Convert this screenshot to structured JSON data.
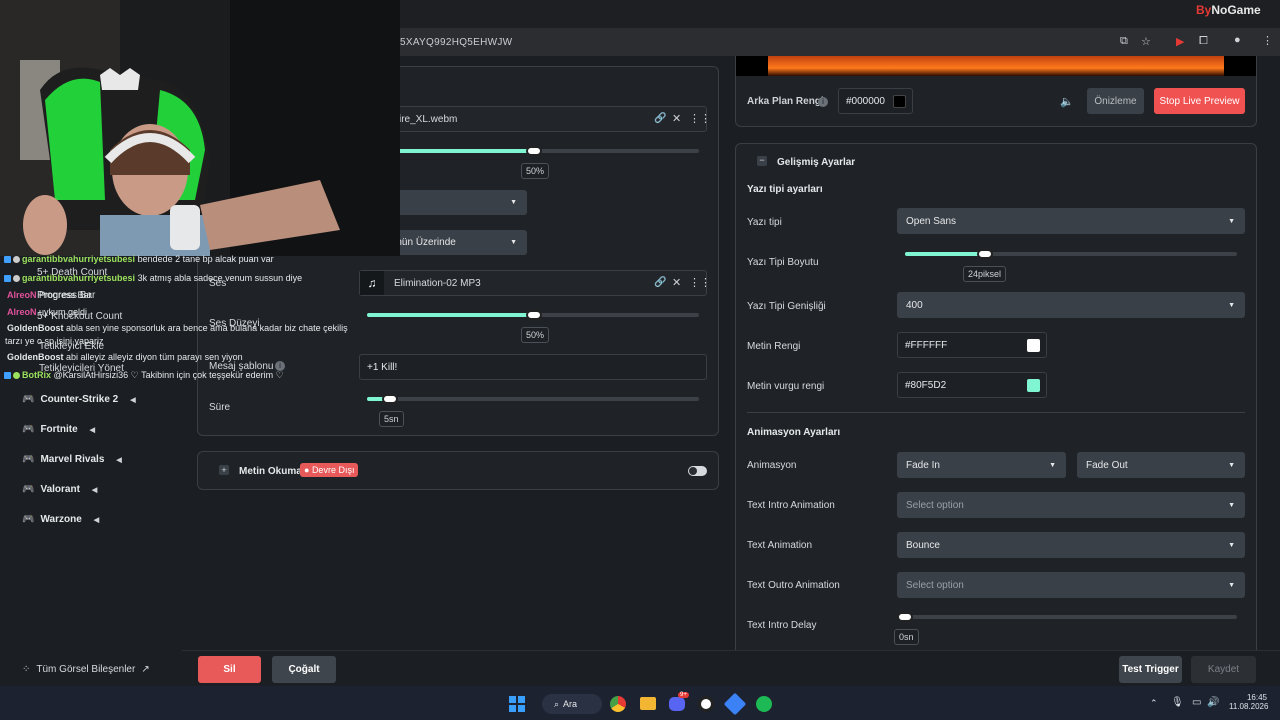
{
  "brand": {
    "logo_a": "By",
    "logo_b": "NoGame"
  },
  "browser": {
    "url": "5XAYQ992HQ5EHWJW"
  },
  "left_panel": {
    "file1": "ire_XL.webm",
    "volume1": "50%",
    "select1_value": "",
    "select2_value": "örüntünün Üzerinde",
    "sound_label": "Ses",
    "file2": "Elimination-02 MP3",
    "volume_label": "Ses Düzeyi",
    "volume2": "50%",
    "template_label": "Mesaj şablonu",
    "template_value": "+1 Kill!",
    "duration_label": "Süre",
    "duration_value": "5sn",
    "tts_label": "Metin Okuma",
    "tts_status": "Devre Dışı"
  },
  "sidebar": {
    "ghost_items": [
      "5+ Death Count",
      "Progress Bar",
      "5+ Knockout Count",
      "Tetikleyici Ekle",
      "Tetikleyicileri Yönet"
    ],
    "games": [
      "Counter-Strike 2",
      "Fortnite",
      "Marvel Rivals",
      "Valorant",
      "Warzone"
    ],
    "footer_link": "Tüm Görsel Bileşenler"
  },
  "chat": [
    {
      "name": "garantibbvahurriyetsubesi",
      "text": "bendede 2 tane bp alcak puan var",
      "color": "#9be15d"
    },
    {
      "name": "garantibbvahurriyetsubesi",
      "text": "3k atmış abla sadece venum sussun diye",
      "color": "#9be15d"
    },
    {
      "name": "AlreoN",
      "text": "Progress Bar",
      "color": "#e0529c"
    },
    {
      "name": "AlreoN",
      "text": "uykum geldi",
      "color": "#e0529c"
    },
    {
      "name": "GoldenBoost",
      "text": "abla sen yine sponsorluk ara bence ama bulana kadar biz chate çekiliş",
      "color": "#ffffff"
    },
    {
      "name": "",
      "text": "tarzı ye o sp işini yapariz",
      "color": "#ffffff"
    },
    {
      "name": "GoldenBoost",
      "text": "abi alleyiz alleyiz diyon tüm parayı sen yiyon",
      "color": "#ffffff"
    },
    {
      "name": "BotRix",
      "text": "@KarsilAtHirsizi36 ♡ Takibinn için çok teşşekür ederim ♡",
      "color": "#9be15d"
    }
  ],
  "preview": {
    "bg_label": "Arka Plan Rengi",
    "bg_value": "#000000",
    "preview_btn": "Önizleme",
    "live_btn": "Stop Live Preview"
  },
  "advanced": {
    "title": "Gelişmiş Ayarlar",
    "font_section": "Yazı tipi ayarları",
    "font_label": "Yazı tipi",
    "font_value": "Open Sans",
    "size_label": "Yazı Tipi Boyutu",
    "size_value": "24piksel",
    "size_fraction": 0.24,
    "weight_label": "Yazı Tipi Genişliği",
    "weight_value": "400",
    "color_label": "Metin Rengi",
    "color_value": "#FFFFFF",
    "accent_label": "Metin vurgu rengi",
    "accent_value": "#80F5D2",
    "anim_section": "Animasyon Ayarları",
    "anim_label": "Animasyon",
    "anim_in": "Fade In",
    "anim_out": "Fade Out",
    "intro_label": "Text Intro Animation",
    "intro_value": "Select option",
    "text_anim_label": "Text Animation",
    "text_anim_value": "Bounce",
    "outro_label": "Text Outro Animation",
    "outro_value": "Select option",
    "delay_label": "Text Intro Delay",
    "delay_value": "0sn"
  },
  "footer": {
    "delete": "Sil",
    "duplicate": "Çoğalt",
    "test": "Test Trigger",
    "save": "Kaydet"
  },
  "taskbar": {
    "search": "Ara",
    "time": "16:45",
    "date": "11.08.2026",
    "discord_badge": "9+"
  },
  "colors": {
    "accent": "#80F5D2",
    "danger": "#e85a5a",
    "live": "#f05252"
  }
}
